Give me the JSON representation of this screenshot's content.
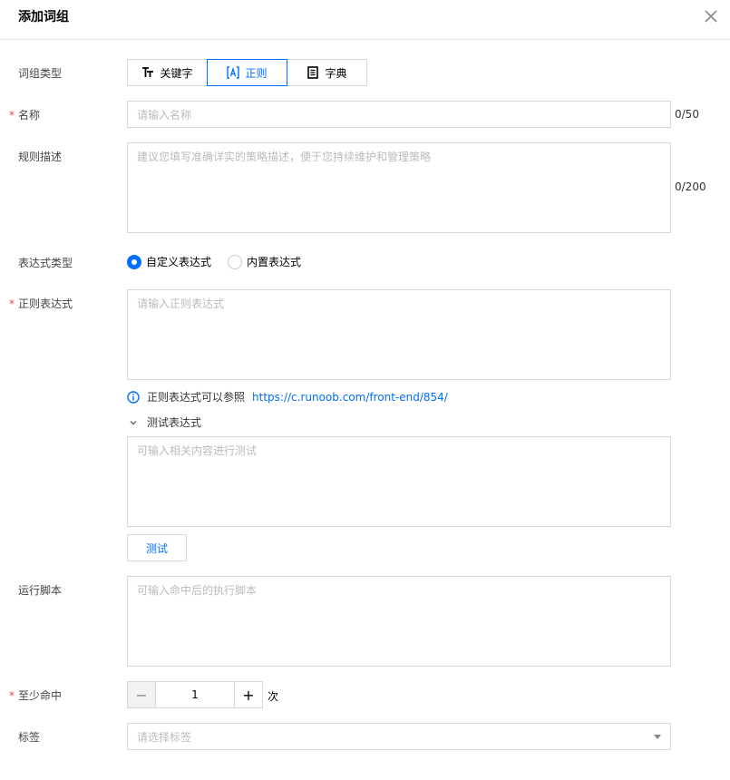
{
  "dialog": {
    "title": "添加词组"
  },
  "form": {
    "type": {
      "label": "词组类型",
      "options": [
        {
          "label": "关键字",
          "icon": "tt-icon"
        },
        {
          "label": "正则",
          "icon": "regex-icon"
        },
        {
          "label": "字典",
          "icon": "dictionary-icon"
        }
      ],
      "selected": "正则"
    },
    "name": {
      "required_mark": "*",
      "label": "名称",
      "placeholder": "请输入名称",
      "counter": "0/50"
    },
    "desc": {
      "label": "规则描述",
      "placeholder": "建议您填写准确详实的策略描述，便于您持续维护和管理策略",
      "counter": "0/200"
    },
    "expr_type": {
      "label": "表达式类型",
      "options": [
        "自定义表达式",
        "内置表达式"
      ],
      "selected": "自定义表达式"
    },
    "regex": {
      "required_mark": "*",
      "label": "正则表达式",
      "placeholder": "请输入正则表达式"
    },
    "hint": {
      "text": "正则表达式可以参照",
      "link": "https://c.runoob.com/front-end/854/"
    },
    "test": {
      "toggle_label": "测试表达式",
      "placeholder": "可输入相关内容进行测试",
      "button": "测试"
    },
    "script": {
      "label": "运行脚本",
      "placeholder": "可输入命中后的执行脚本"
    },
    "min_hits": {
      "required_mark": "*",
      "label": "至少命中",
      "value": "1",
      "unit": "次",
      "dec": "−",
      "inc": "+"
    },
    "tags": {
      "label": "标签",
      "placeholder": "请选择标签"
    }
  },
  "colors": {
    "accent": "#006eff",
    "required": "#e54545",
    "border": "#d8d8d8"
  }
}
